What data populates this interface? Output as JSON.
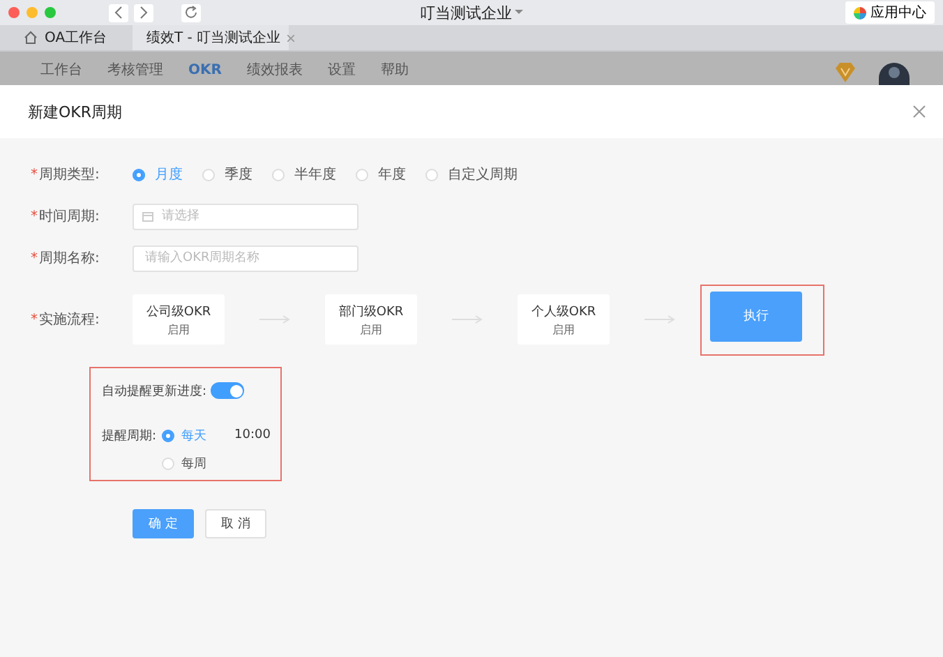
{
  "browser": {
    "title": "叮当测试企业",
    "app_center": "应用中心",
    "tabs": [
      {
        "label": "OA工作台",
        "selected": false
      },
      {
        "label": "绩效T - 叮当测试企业",
        "selected": true
      }
    ]
  },
  "nav": {
    "items": [
      {
        "label": "工作台",
        "selected": false
      },
      {
        "label": "考核管理",
        "selected": false
      },
      {
        "label": "OKR",
        "selected": true
      },
      {
        "label": "绩效报表",
        "selected": false
      },
      {
        "label": "设置",
        "selected": false
      },
      {
        "label": "帮助",
        "selected": false
      }
    ]
  },
  "dialog": {
    "title": "新建OKR周期",
    "cycle_type": {
      "label": "周期类型:",
      "required_mark": "*",
      "options": [
        {
          "label": "月度",
          "selected": true
        },
        {
          "label": "季度",
          "selected": false
        },
        {
          "label": "半年度",
          "selected": false
        },
        {
          "label": "年度",
          "selected": false
        },
        {
          "label": "自定义周期",
          "selected": false
        }
      ]
    },
    "time_period": {
      "label": "时间周期:",
      "required_mark": "*",
      "placeholder": "请选择"
    },
    "cycle_name": {
      "label": "周期名称:",
      "required_mark": "*",
      "placeholder": "请输入OKR周期名称"
    },
    "flow": {
      "label": "实施流程:",
      "required_mark": "*",
      "steps": [
        {
          "title": "公司级OKR",
          "status": "启用"
        },
        {
          "title": "部门级OKR",
          "status": "启用"
        },
        {
          "title": "个人级OKR",
          "status": "启用"
        }
      ],
      "action": "执行",
      "highlighted": true
    },
    "reminder": {
      "highlighted": true,
      "auto_label": "自动提醒更新进度:",
      "auto_on": true,
      "period_label": "提醒周期:",
      "options": [
        {
          "label": "每天",
          "selected": true,
          "time": "10:00"
        },
        {
          "label": "每周",
          "selected": false
        }
      ]
    },
    "buttons": [
      {
        "label": "确 定",
        "kind": "primary"
      },
      {
        "label": "取 消",
        "kind": "default"
      }
    ]
  }
}
